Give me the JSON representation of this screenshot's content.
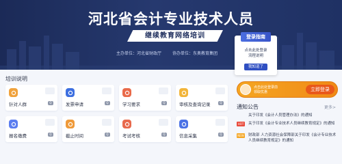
{
  "banner": {
    "title": "河北省会计专业技术人员",
    "subtitle": "继续教育网络培训",
    "sponsor": "主办单位：河北省财政厅",
    "organizer": "协办单位：东奥教育集团"
  },
  "login_card": {
    "tag": "登录指南",
    "hint_line1": "点击此处登录",
    "hint_line2": "流程说明",
    "button": "我知道了"
  },
  "section_title": "培训说明",
  "tiles": [
    {
      "label": "针对人群",
      "icon": "people-icon",
      "color": "#f0a23c"
    },
    {
      "label": "发票申请",
      "icon": "invoice-icon",
      "color": "#3d6fe0"
    },
    {
      "label": "学习要求",
      "icon": "book-icon",
      "color": "#e96a4a"
    },
    {
      "label": "审核及查询记录",
      "icon": "search-record-icon",
      "color": "#f2b53a"
    },
    {
      "label": "报名缴费",
      "icon": "payment-icon",
      "color": "#5b7df0"
    },
    {
      "label": "截止时间",
      "icon": "clock-icon",
      "color": "#ef9a3a"
    },
    {
      "label": "考试考核",
      "icon": "exam-icon",
      "color": "#e86a4d"
    },
    {
      "label": "信息采集",
      "icon": "info-icon",
      "color": "#4b72e6"
    }
  ],
  "tile_badge": "Q",
  "promo": {
    "text_line1": "点击此处登录前",
    "text_line2": "领取优惠",
    "button": "立即登录"
  },
  "notices": {
    "title": "通知公告",
    "more": "更多>",
    "items": [
      {
        "tag": "",
        "text": "关于印发《会计人员管理办法》的通知"
      },
      {
        "tag": "HOT",
        "text": "关于印发《会计专业技术人员继续教育规定》的通知"
      },
      {
        "tag": "NEW",
        "text": "财政部 人力资源社会保障部关于印发《会计专业技术人员继续教育规定》的通知"
      }
    ]
  }
}
